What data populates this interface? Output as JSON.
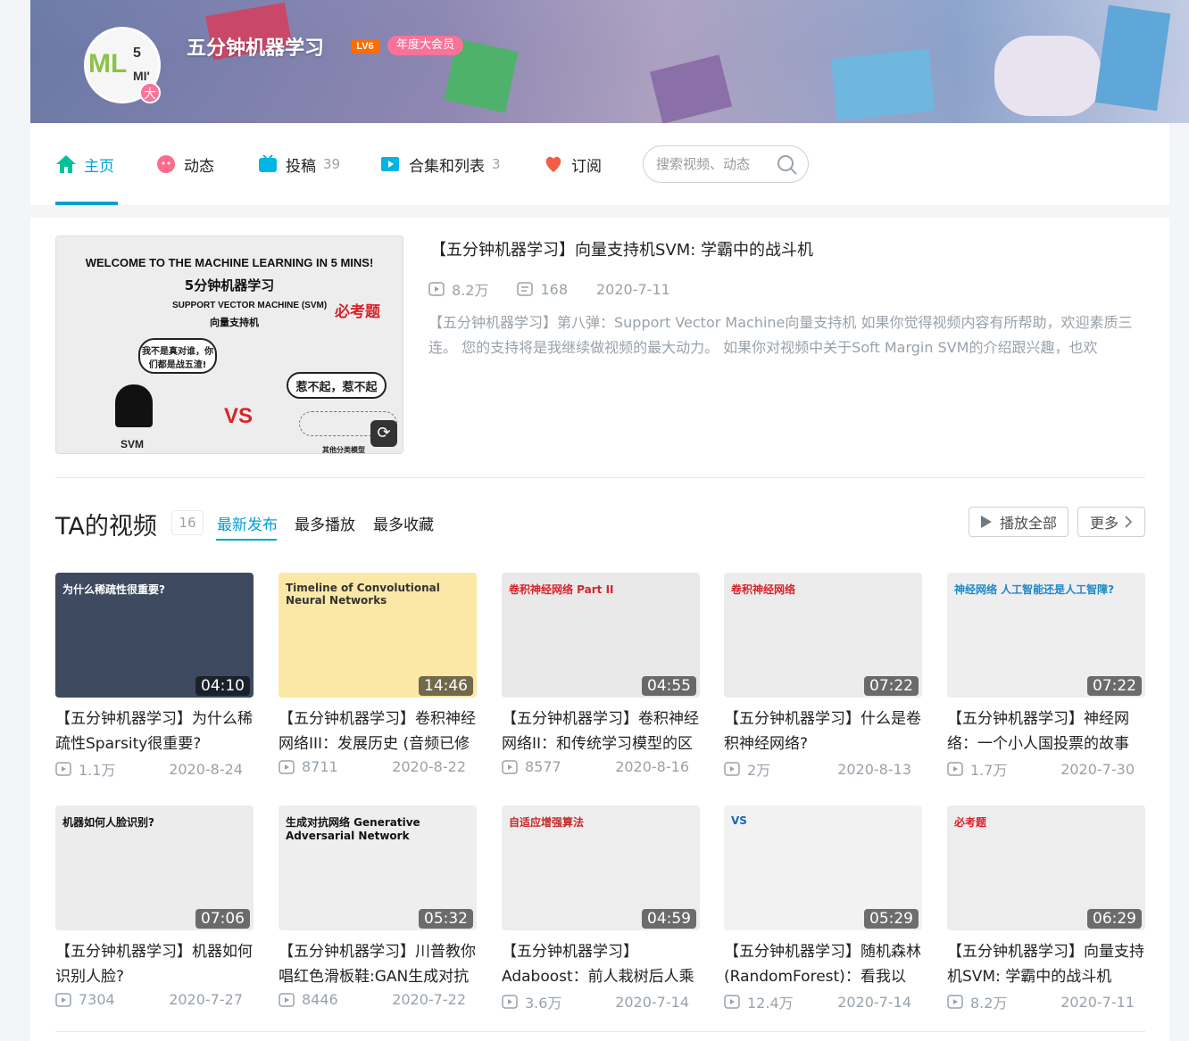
{
  "profile": {
    "name": "五分钟机器学习",
    "level": "LV6",
    "vip_label": "年度大会员",
    "avatar_badge": "大",
    "avatar_text": {
      "ml": "ML",
      "five": "5",
      "mi": "MI'"
    }
  },
  "nav": {
    "home": "主页",
    "dynamic": "动态",
    "uploads": "投稿",
    "uploads_count": "39",
    "collections": "合集和列表",
    "collections_count": "3",
    "subscribe": "订阅",
    "search_placeholder": "搜索视频、动态"
  },
  "featured": {
    "title": "【五分钟机器学习】向量支持机SVM: 学霸中的战斗机",
    "views": "8.2万",
    "comments": "168",
    "date": "2020-7-11",
    "description": "【五分钟机器学习】第八弹：Support Vector Machine向量支持机 如果你觉得视频内容有所帮助，欢迎素质三连。 您的支持将是我继续做视频的最大动力。 如果你对视频中关于Soft Margin SVM的介绍跟兴趣，也欢",
    "thumb": {
      "headline": "WELCOME TO THE MACHINE LEARNING IN 5 MINS!",
      "sub": "5分钟机器学习",
      "svm_en": "SUPPORT VECTOR MACHINE (SVM)",
      "svm_cn": "向量支持机",
      "must": "必考题",
      "vs": "VS",
      "bubble1": "我不是真对谁，你们都是战五渣!",
      "bubble2": "惹不起，惹不起",
      "svm_label": "SVM",
      "others": "其他分类模型"
    }
  },
  "videos_section": {
    "title": "TA的视频",
    "count": "16",
    "tabs": [
      "最新发布",
      "最多播放",
      "最多收藏"
    ],
    "play_all": "播放全部",
    "more": "更多"
  },
  "videos": [
    {
      "title": "【五分钟机器学习】为什么稀疏性Sparsity很重要?",
      "views": "1.1万",
      "date": "2020-8-24",
      "duration": "04:10",
      "tag": "为什么稀疏性很重要?",
      "bg": "#3d4a60"
    },
    {
      "title": "【五分钟机器学习】卷积神经网络III：发展历史 (音频已修",
      "views": "8711",
      "date": "2020-8-22",
      "duration": "14:46",
      "tag": "Timeline of Convolutional Neural Networks",
      "bg": "#fbe8a6"
    },
    {
      "title": "【五分钟机器学习】卷积神经网络II：和传统学习模型的区",
      "views": "8577",
      "date": "2020-8-16",
      "duration": "04:55",
      "tag": "卷积神经网络 Part II",
      "bg": "#e9e9e9"
    },
    {
      "title": "【五分钟机器学习】什么是卷积神经网络?",
      "views": "2万",
      "date": "2020-8-13",
      "duration": "07:22",
      "tag": "卷积神经网络",
      "bg": "#ececec"
    },
    {
      "title": "【五分钟机器学习】神经网络：一个小人国投票的故事",
      "views": "1.7万",
      "date": "2020-7-30",
      "duration": "07:22",
      "tag": "神经网络 人工智能还是人工智障?",
      "bg": "#eeeeee"
    },
    {
      "title": "【五分钟机器学习】机器如何识别人脸?",
      "views": "7304",
      "date": "2020-7-27",
      "duration": "07:06",
      "tag": "机器如何人脸识别?",
      "bg": "#ececec"
    },
    {
      "title": "【五分钟机器学习】川普教你唱红色滑板鞋:GAN生成对抗",
      "views": "8446",
      "date": "2020-7-22",
      "duration": "05:32",
      "tag": "生成对抗网络 Generative Adversarial Network",
      "bg": "#eeeeee"
    },
    {
      "title": "【五分钟机器学习】Adaboost：前人栽树后人乘",
      "views": "3.6万",
      "date": "2020-7-14",
      "duration": "04:59",
      "tag": "自适应增强算法",
      "bg": "#ededed"
    },
    {
      "title": "【五分钟机器学习】随机森林(RandomForest)：看我以",
      "views": "12.4万",
      "date": "2020-7-14",
      "duration": "05:29",
      "tag": "VS",
      "bg": "#f2f2f2"
    },
    {
      "title": "【五分钟机器学习】向量支持机SVM: 学霸中的战斗机",
      "views": "8.2万",
      "date": "2020-7-11",
      "duration": "06:29",
      "tag": "必考题",
      "bg": "#ededed"
    }
  ],
  "colors": {
    "accent": "#00a1d6",
    "pink": "#fb7299",
    "muted": "#99a2aa"
  }
}
